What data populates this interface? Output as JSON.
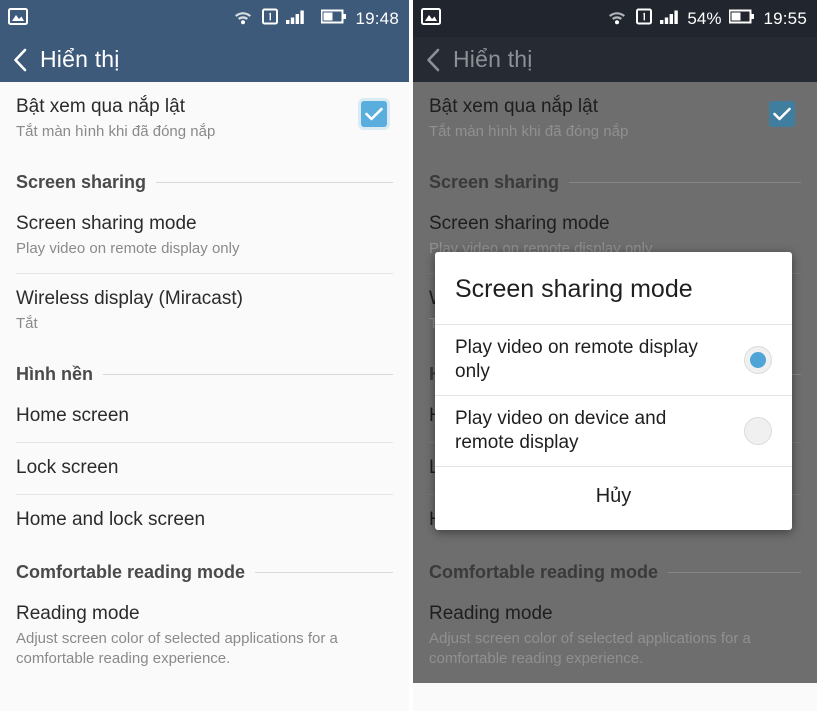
{
  "theme": {
    "accent_blue": "#5aaede",
    "radio_blue": "#4fa4d8",
    "header_left": "#3d5a7a",
    "header_right": "#262b33",
    "statusbar_right": "#20252e",
    "dim_overlay": "#6e6e6e"
  },
  "left_screen": {
    "statusbar": {
      "notification_icon": "image-icon",
      "wifi_icon": "wifi-icon",
      "sim_icon": "sim-1-icon",
      "signal_icon": "signal-bars-icon",
      "battery_icon": "battery-icon",
      "battery_percent": "",
      "time": "19:48"
    },
    "actionbar": {
      "back_icon": "back-chevron-icon",
      "title": "Hiển thị"
    },
    "items": [
      {
        "type": "row",
        "name": "flip-cover-row",
        "title": "Bật xem qua nắp lật",
        "summary": "Tắt màn hình khi đã đóng nắp",
        "widget": "checkbox",
        "checked": true
      },
      {
        "type": "section",
        "name": "section-screen-sharing",
        "label": "Screen sharing"
      },
      {
        "type": "row",
        "name": "screen-sharing-mode-row",
        "title": "Screen sharing mode",
        "summary": "Play video on remote display only"
      },
      {
        "type": "divider"
      },
      {
        "type": "row",
        "name": "wireless-display-row",
        "title": "Wireless display (Miracast)",
        "summary": "Tắt"
      },
      {
        "type": "section",
        "name": "section-wallpaper",
        "label": "Hình nền"
      },
      {
        "type": "row",
        "name": "home-screen-row",
        "title": "Home screen",
        "summary": ""
      },
      {
        "type": "divider"
      },
      {
        "type": "row",
        "name": "lock-screen-row",
        "title": "Lock screen",
        "summary": ""
      },
      {
        "type": "divider"
      },
      {
        "type": "row",
        "name": "home-and-lock-screen-row",
        "title": "Home and lock screen",
        "summary": ""
      },
      {
        "type": "section",
        "name": "section-comfortable-reading",
        "label": "Comfortable reading mode"
      },
      {
        "type": "row",
        "name": "reading-mode-row",
        "title": "Reading mode",
        "summary": "Adjust screen color of selected applications for a comfortable reading experience."
      }
    ]
  },
  "right_screen": {
    "statusbar": {
      "notification_icon": "image-icon",
      "wifi_icon": "wifi-icon",
      "sim_icon": "sim-1-icon",
      "signal_icon": "signal-bars-icon",
      "battery_icon": "battery-icon",
      "battery_percent": "54%",
      "time": "19:55"
    },
    "actionbar": {
      "back_icon": "back-chevron-icon",
      "title": "Hiển thị"
    },
    "items": [
      {
        "type": "row",
        "name": "flip-cover-row",
        "title": "Bật xem qua nắp lật",
        "summary": "Tắt màn hình khi đã đóng nắp",
        "widget": "checkbox",
        "checked": true
      },
      {
        "type": "section",
        "name": "section-screen-sharing",
        "label": "Screen sharing"
      },
      {
        "type": "row",
        "name": "screen-sharing-mode-row",
        "title": "Screen sharing mode",
        "summary": "Play video on remote display only"
      },
      {
        "type": "divider"
      },
      {
        "type": "row",
        "name": "wireless-display-row",
        "title": "Wireless display (Miracast)",
        "summary": "Tắt"
      },
      {
        "type": "section",
        "name": "section-wallpaper",
        "label": "Hình nền"
      },
      {
        "type": "row",
        "name": "home-screen-row",
        "title": "Home screen",
        "summary": ""
      },
      {
        "type": "divider"
      },
      {
        "type": "row",
        "name": "lock-screen-row",
        "title": "Lock screen",
        "summary": ""
      },
      {
        "type": "divider"
      },
      {
        "type": "row",
        "name": "home-and-lock-screen-row",
        "title": "Home and lock screen",
        "summary": ""
      },
      {
        "type": "section",
        "name": "section-comfortable-reading",
        "label": "Comfortable reading mode"
      },
      {
        "type": "row",
        "name": "reading-mode-row",
        "title": "Reading mode",
        "summary": "Adjust screen color of selected applications for a comfortable reading experience."
      }
    ],
    "dialog": {
      "title": "Screen sharing mode",
      "options": [
        {
          "label": "Play video on remote display only",
          "selected": true
        },
        {
          "label": "Play video on device and remote display",
          "selected": false
        }
      ],
      "cancel_label": "Hủy"
    }
  }
}
